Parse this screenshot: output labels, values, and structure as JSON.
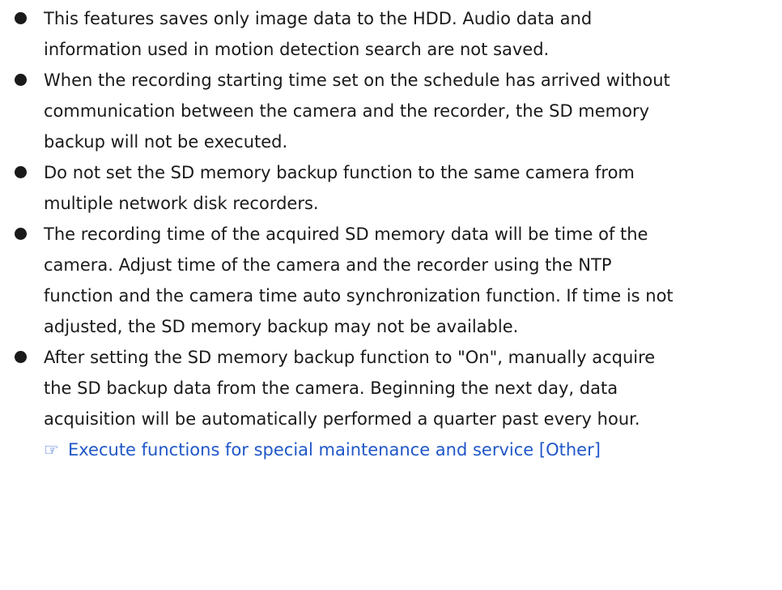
{
  "notes": [
    {
      "lines": [
        "This features saves only image data to the HDD. Audio data and",
        "information used in motion detection search are not saved."
      ]
    },
    {
      "lines": [
        "When the recording starting time set on the schedule has arrived without",
        "communication between the camera and the recorder, the SD memory",
        "backup will not be executed."
      ]
    },
    {
      "lines": [
        "Do not set the SD memory backup function to the same camera from",
        "multiple network disk recorders."
      ]
    },
    {
      "lines": [
        "The recording time of the acquired SD memory data will be time of the",
        "camera. Adjust time of the camera and the recorder using the NTP",
        "function and the camera time auto synchronization function. If time is not",
        "adjusted, the SD memory backup may not be available."
      ]
    },
    {
      "lines": [
        "After setting the SD memory backup function to \"On\", manually acquire",
        "the SD backup data from the camera. Beginning the next day, data",
        "acquisition will be automatically performed a quarter past every hour."
      ],
      "reference": {
        "icon": "☞",
        "text": "Execute functions for special maintenance and service [Other]"
      }
    }
  ]
}
